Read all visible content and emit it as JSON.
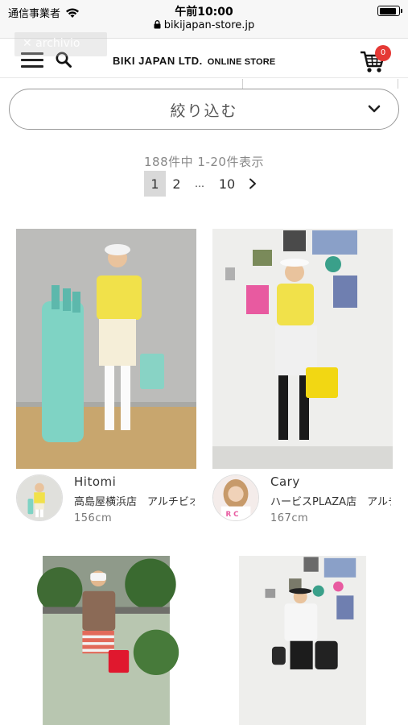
{
  "status_bar": {
    "carrier": "通信事業者",
    "time": "午前10:00",
    "url": "bikijapan-store.jp",
    "battery_level": 0.9
  },
  "header": {
    "overlay_tag": "✕ archivio",
    "brand": "BIKI JAPAN LTD.",
    "brand_sub": "ONLINE STORE",
    "cart_count": "0",
    "icons": [
      "menu-icon",
      "search-icon",
      "cart-icon"
    ]
  },
  "filter": {
    "label": "絞り込む",
    "icon": "chevron-down-icon"
  },
  "results": {
    "summary": "188件中 1-20件表示"
  },
  "pagination": {
    "pages": [
      "1",
      "2",
      "…",
      "10"
    ],
    "current": "1",
    "next_icon": "chevron-right-icon"
  },
  "staff_cards": [
    {
      "name": "Hitomi",
      "store": "高島屋横浜店　アルチビオ",
      "height": "156cm"
    },
    {
      "name": "Cary",
      "store": "ハービスPLAZA店　アルチビオ",
      "height": "167cm"
    },
    {
      "name": "",
      "store": "",
      "height": ""
    },
    {
      "name": "",
      "store": "",
      "height": ""
    }
  ],
  "colors": {
    "cart_badge": "#e53935",
    "current_page_bg": "#d9d9d9",
    "filter_border": "#9a9a9a"
  }
}
